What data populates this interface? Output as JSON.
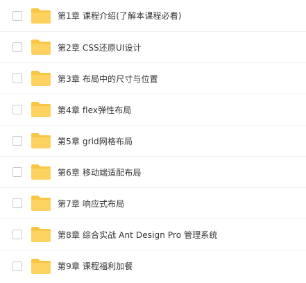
{
  "colors": {
    "folder_body": "#fdd260",
    "folder_tab": "#f7c744",
    "text": "#333333",
    "divider": "#efefef"
  },
  "icons": {
    "folder": "folder-icon",
    "checkbox": "checkbox-unchecked"
  },
  "files": [
    {
      "name": "第1章 课程介绍(了解本课程必看)"
    },
    {
      "name": "第2章 CSS还原UI设计"
    },
    {
      "name": "第3章 布局中的尺寸与位置"
    },
    {
      "name": "第4章 flex弹性布局"
    },
    {
      "name": "第5章 grid网格布局"
    },
    {
      "name": "第6章 移动端适配布局"
    },
    {
      "name": "第7章 响应式布局"
    },
    {
      "name": "第8章 综合实战 Ant Design Pro 管理系统"
    },
    {
      "name": "第9章 课程福利加餐"
    }
  ]
}
